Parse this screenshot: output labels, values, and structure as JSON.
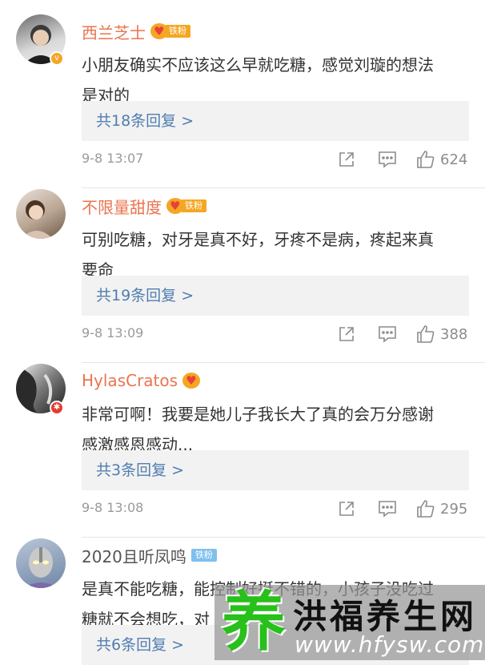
{
  "comments": [
    {
      "username": "西兰芝士",
      "fan_label": "铁粉",
      "text_line1": "小朋友确实不应该这么早就吃糖，感觉刘璇的想法",
      "text_line2": "是对的",
      "reply_label": "共18条回复 >",
      "time": "9-8 13:07",
      "likes": "624"
    },
    {
      "username": "不限量甜度",
      "fan_label": "铁粉",
      "text_line1": "可别吃糖，对牙是真不好，牙疼不是病，疼起来真",
      "text_line2": "要命",
      "reply_label": "共19条回复 >",
      "time": "9-8 13:09",
      "likes": "388"
    },
    {
      "username": "HylasCratos",
      "text_line1": "非常可啊！我要是她儿子我长大了真的会万分感谢",
      "text_line2": "感激感恩感动...",
      "reply_label": "共3条回复 >",
      "time": "9-8 13:08",
      "likes": "295"
    },
    {
      "username": "2020且听凤鸣",
      "fan_label": "铁粉",
      "text_line1": "是真不能吃糖，能控制好挺不错的，小孩子没吃过",
      "text_line2": "糖就不会想吃，对",
      "reply_label": "共6条回复 >"
    }
  ],
  "watermark": {
    "char": "养",
    "title": "洪福养生网",
    "url": "www.hfysw.com"
  },
  "icons": {
    "share": "share-icon",
    "comment": "comment-icon",
    "like": "thumbs-up-icon"
  }
}
